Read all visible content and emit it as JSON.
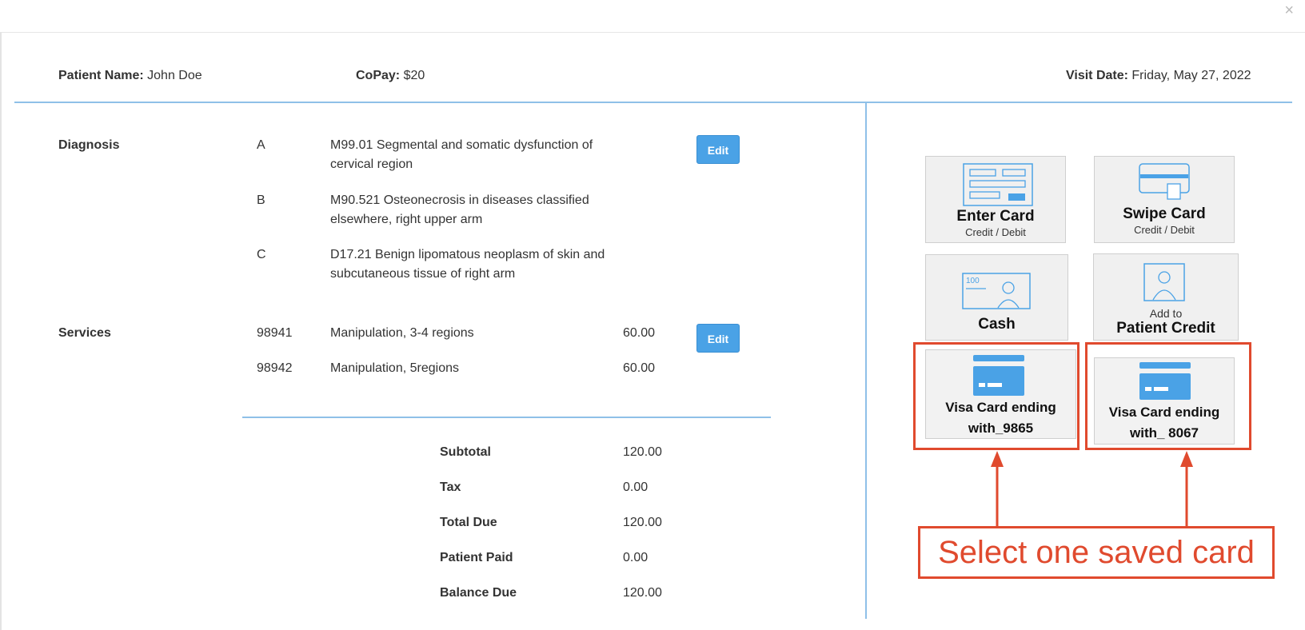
{
  "modal": {
    "close_glyph": "×"
  },
  "header": {
    "patient_label": "Patient Name:",
    "patient_value": "John Doe",
    "copay_label": "CoPay:",
    "copay_value": "$20",
    "visit_label": "Visit Date:",
    "visit_value": "Friday, May 27, 2022"
  },
  "diagnosis": {
    "title": "Diagnosis",
    "edit_label": "Edit",
    "items": [
      {
        "letter": "A",
        "line1": "M99.01  Segmental and somatic dysfunction of",
        "line2": "cervical region"
      },
      {
        "letter": "B",
        "line1": "M90.521  Osteonecrosis in diseases classified",
        "line2": "elsewhere, right upper arm"
      },
      {
        "letter": "C",
        "line1": "D17.21  Benign lipomatous neoplasm of skin and",
        "line2": "subcutaneous tissue of right arm"
      }
    ]
  },
  "services": {
    "title": "Services",
    "edit_label": "Edit",
    "items": [
      {
        "code": "98941",
        "desc": "Manipulation, 3-4 regions",
        "amount": "60.00"
      },
      {
        "code": "98942",
        "desc": "Manipulation, 5regions",
        "amount": "60.00"
      }
    ]
  },
  "summary": {
    "rows": [
      {
        "label": "Subtotal",
        "value": "120.00"
      },
      {
        "label": "Tax",
        "value": "0.00"
      },
      {
        "label": "Total Due",
        "value": "120.00"
      },
      {
        "label": "Patient Paid",
        "value": "0.00"
      },
      {
        "label": "Balance Due",
        "value": "120.00"
      }
    ]
  },
  "payment": {
    "enter_card": {
      "title": "Enter Card",
      "sub": "Credit / Debit"
    },
    "swipe_card": {
      "title": "Swipe Card",
      "sub": "Credit / Debit"
    },
    "cash": {
      "title": "Cash",
      "icon_text": "100"
    },
    "patient_credit": {
      "pre": "Add to",
      "title": "Patient Credit"
    },
    "saved_cards": [
      {
        "line1": "Visa Card ending",
        "line2": "with_9865"
      },
      {
        "line1": "Visa Card ending",
        "line2": "with_ 8067"
      }
    ]
  },
  "annotation": {
    "callout": "Select one saved card"
  },
  "colors": {
    "accent_blue": "#4aa2e6",
    "divider_blue": "#8fc0e8",
    "annotation_red": "#e04a2e"
  }
}
